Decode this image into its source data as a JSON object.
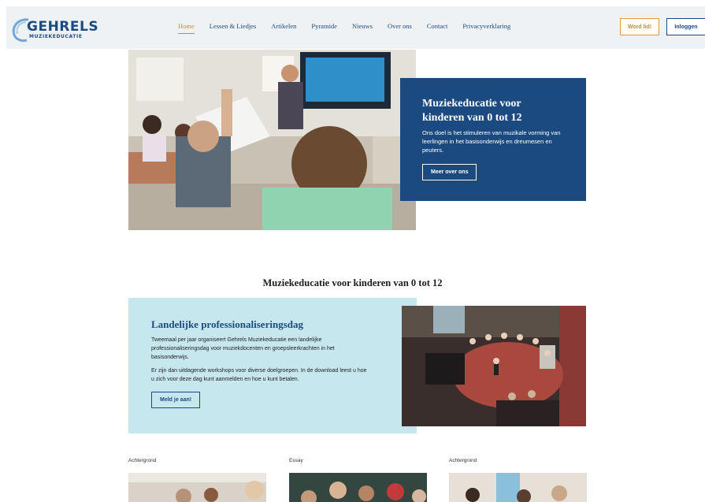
{
  "header": {
    "logo": {
      "main": "GEHRELS",
      "sub": "MUZIEKEDUCATIE"
    },
    "nav": [
      {
        "label": "Home",
        "active": true
      },
      {
        "label": "Lessen & Liedjes",
        "active": false
      },
      {
        "label": "Artikelen",
        "active": false
      },
      {
        "label": "Pyramide",
        "active": false
      },
      {
        "label": "Nieuws",
        "active": false
      },
      {
        "label": "Over ons",
        "active": false
      },
      {
        "label": "Contact",
        "active": false
      },
      {
        "label": "Privacyverklaring",
        "active": false
      }
    ],
    "join_label": "Word lid!",
    "login_label": "Inloggen"
  },
  "hero": {
    "title": "Muziekeducatie voor kinderen van 0 tot 12",
    "text": "Ons doel is het stimuleren van muzikale vorming van leerlingen in het basisonderwijs en dreumesen en peuters.",
    "button": "Meer over ons"
  },
  "section": {
    "title": "Muziekeducatie voor kinderen van 0 tot 12"
  },
  "event": {
    "title": "Landelijke professionaliseringsdag",
    "p1": "Tweemaal per jaar organiseert Gehrels Muziekeducatie een landelijke professionaliseringsdag voor muziekdocenten en groepsleerkrachten in het basisonderwijs.",
    "p2": "Er zijn dan uitdagende workshops voor diverse doelgroepen. In de download leest u hoe u zich voor deze dag kunt aanmelden en hoe u kunt betalen.",
    "button": "Meld je aan!"
  },
  "cards": [
    {
      "category": "Achtergrond"
    },
    {
      "category": "Essay"
    },
    {
      "category": "Achtergrond"
    }
  ],
  "colors": {
    "primary": "#1b4a80",
    "accent": "#d4881f",
    "light_blue": "#c7e7ef",
    "header_bg": "#eef2f5"
  }
}
